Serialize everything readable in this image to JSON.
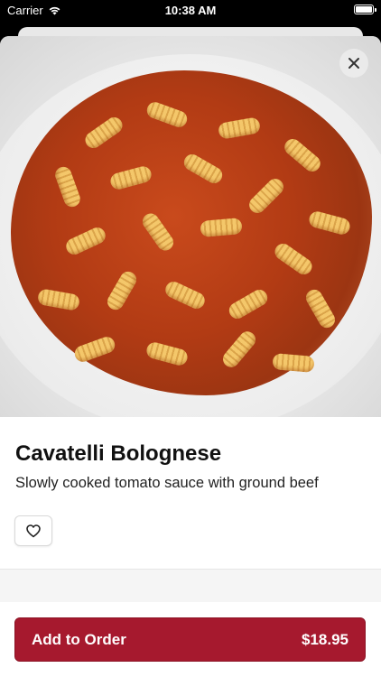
{
  "status_bar": {
    "carrier": "Carrier",
    "time": "10:38 AM"
  },
  "item": {
    "name": "Cavatelli Bolognese",
    "description": "Slowly cooked tomato sauce with ground beef"
  },
  "order_button": {
    "label": "Add to Order",
    "price": "$18.95"
  },
  "colors": {
    "accent": "#a6192e"
  },
  "icons": {
    "close": "close-icon",
    "favorite": "heart-icon",
    "wifi": "wifi-icon",
    "battery": "battery-icon"
  }
}
